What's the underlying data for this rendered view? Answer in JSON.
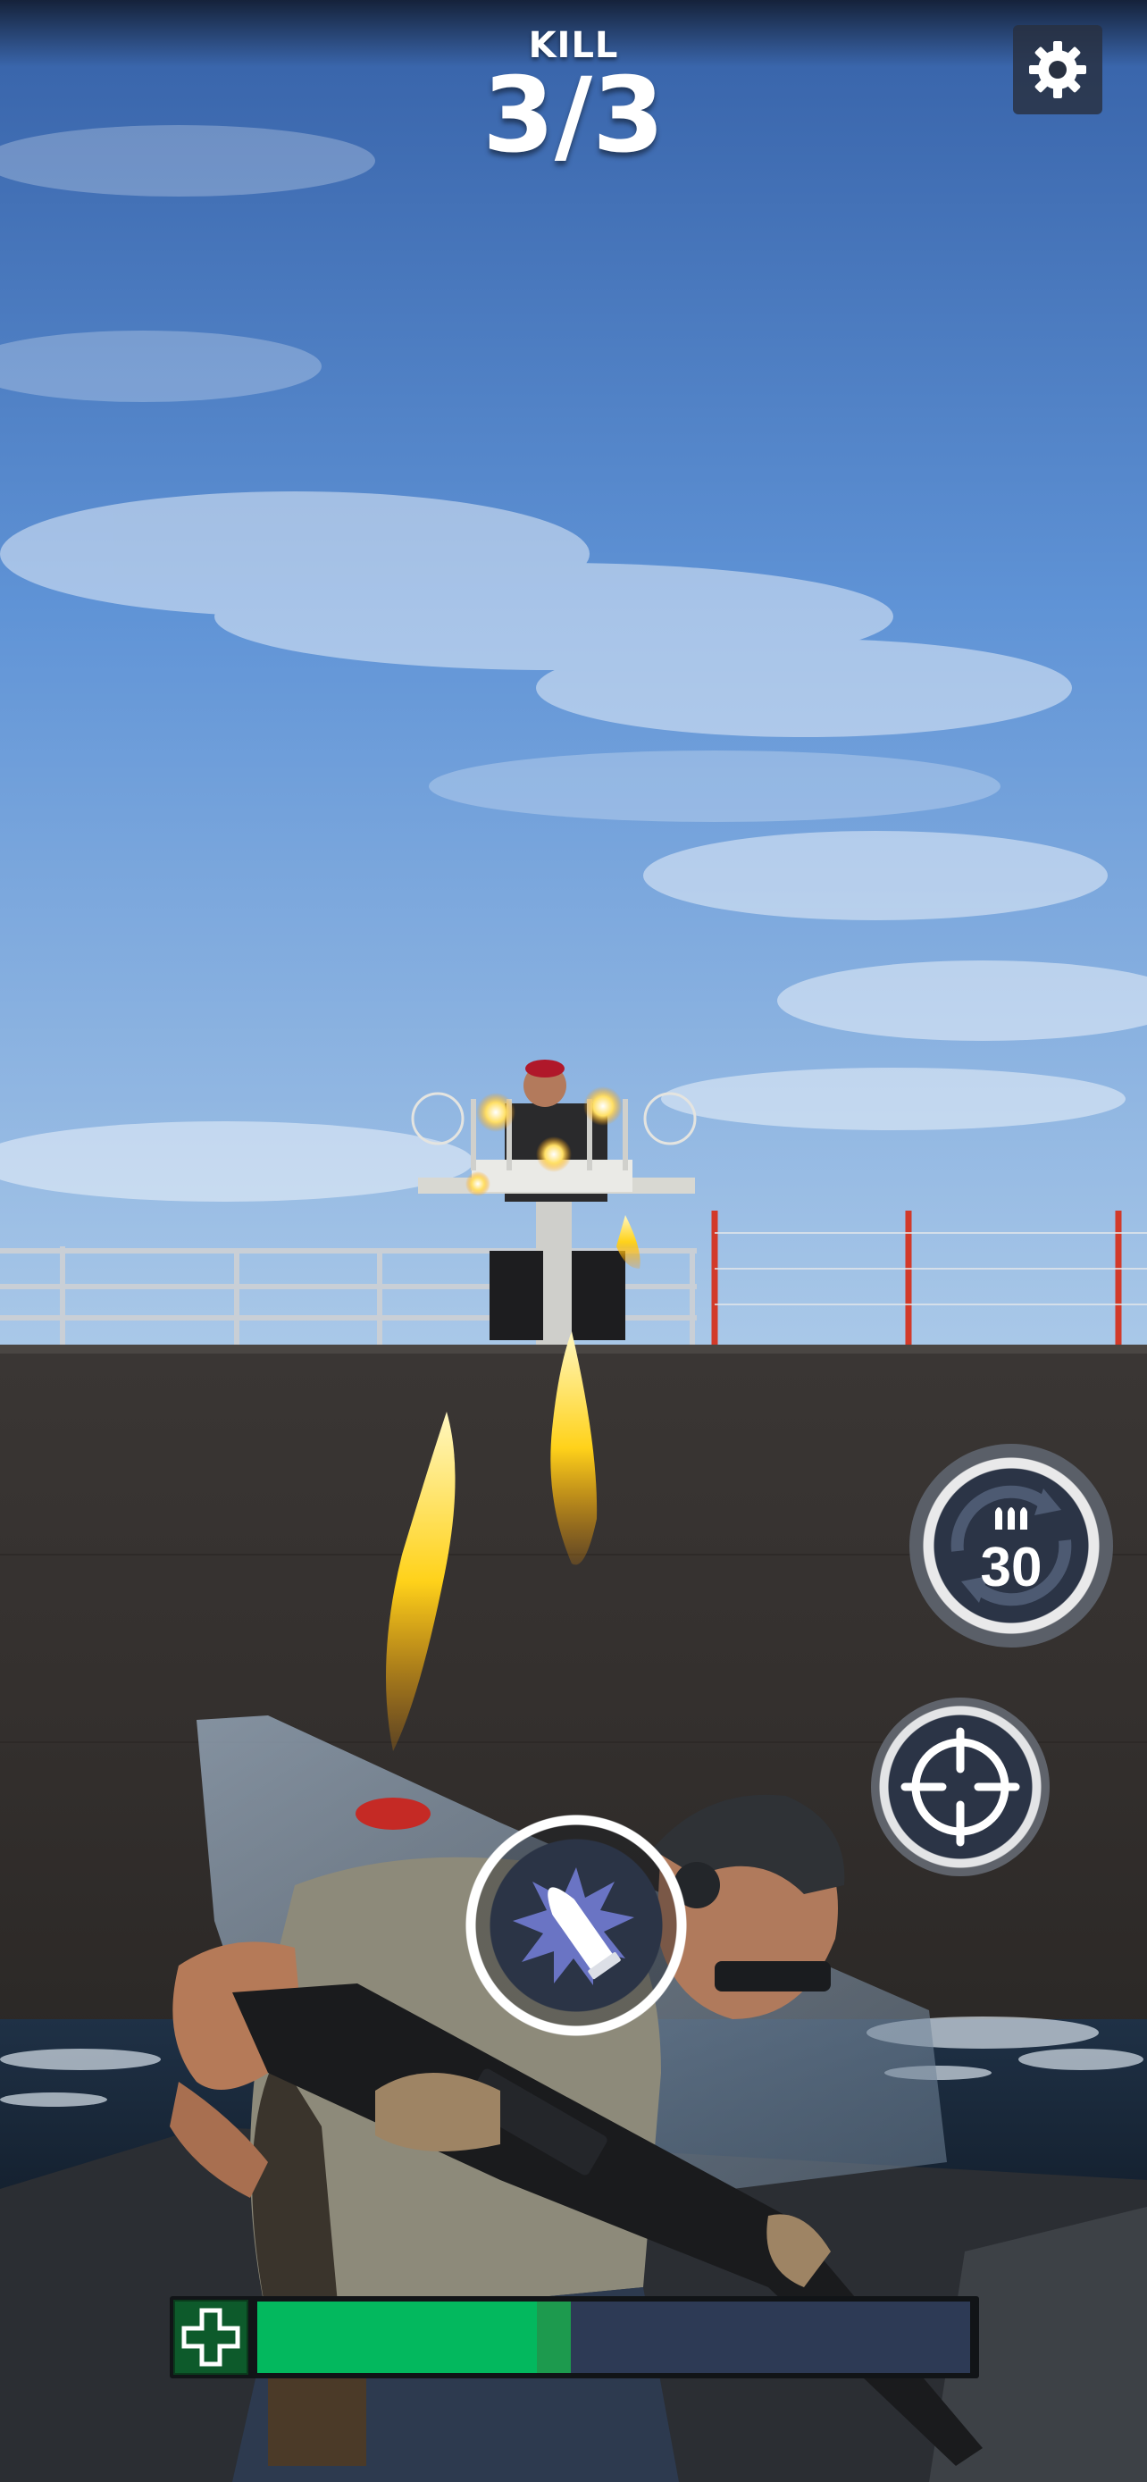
{
  "hud": {
    "kill_label": "KILL",
    "kill_count": "3/3",
    "settings_icon": "gear-icon"
  },
  "controls": {
    "reload_icon": "reload-ammo-icon",
    "ammo_count": "30",
    "aim_icon": "crosshair-icon",
    "fire_icon": "bullet-fire-icon"
  },
  "player": {
    "health_fraction": 0.44,
    "health_icon": "medical-cross-icon"
  },
  "colors": {
    "sky_top": "#3f6fb8",
    "sky_bottom": "#a9c8e8",
    "hull": "#3a3634",
    "health_green": "#03b85e",
    "health_track": "#2d3a55",
    "button_dark": "#2b3446"
  }
}
